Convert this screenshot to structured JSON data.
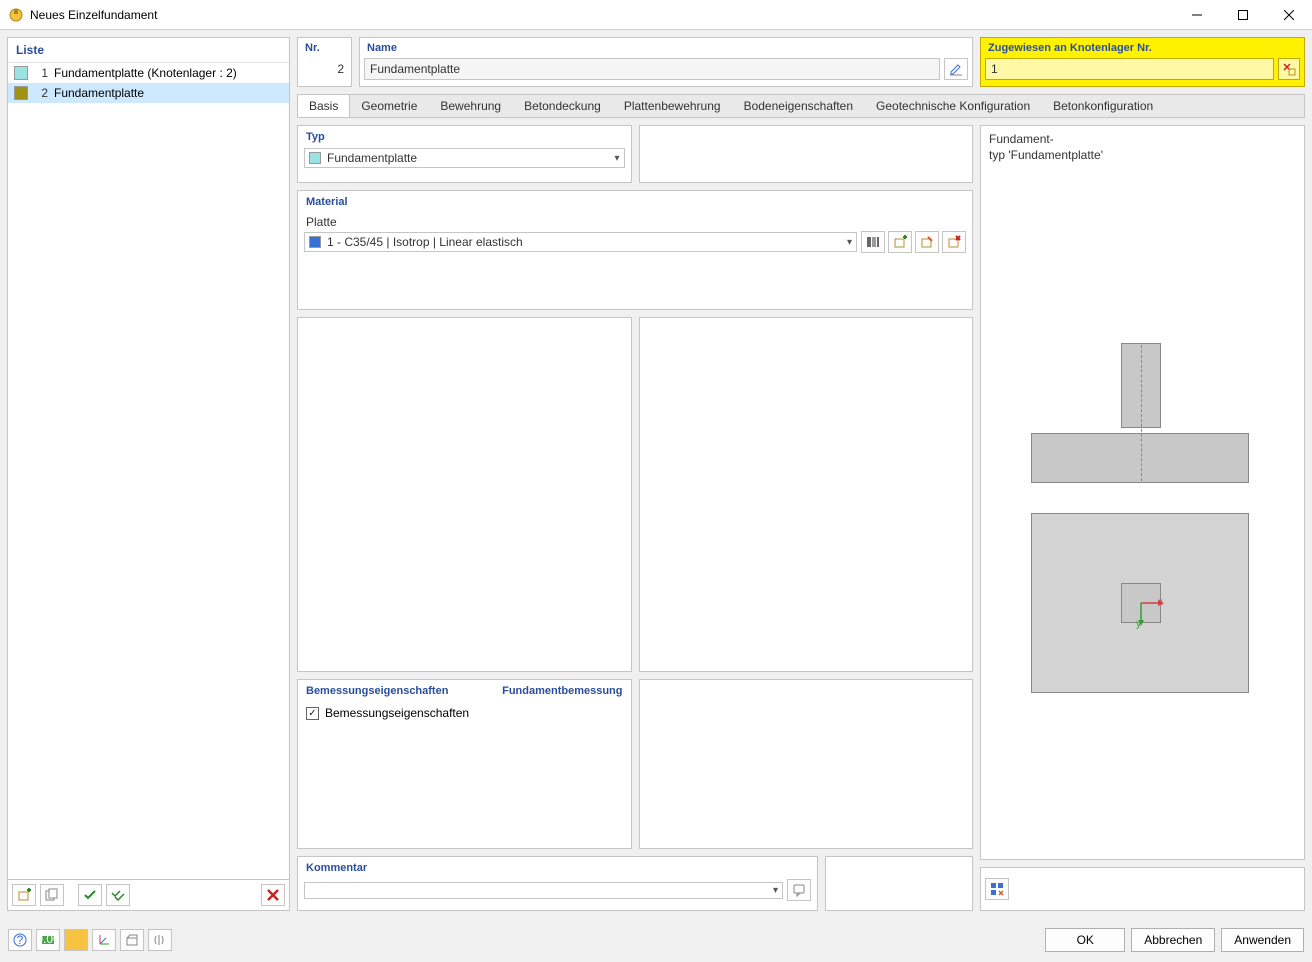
{
  "title": "Neues Einzelfundament",
  "list": {
    "header": "Liste",
    "items": [
      {
        "idx": "1",
        "label": "Fundamentplatte (Knotenlager : 2)",
        "swatch": "teal",
        "selected": false
      },
      {
        "idx": "2",
        "label": "Fundamentplatte",
        "swatch": "olive",
        "selected": true
      }
    ]
  },
  "hdr": {
    "nr_label": "Nr.",
    "nr_value": "2",
    "name_label": "Name",
    "name_value": "Fundamentplatte",
    "assign_label": "Zugewiesen an Knotenlager Nr.",
    "assign_value": "1"
  },
  "tabs": [
    "Basis",
    "Geometrie",
    "Bewehrung",
    "Betondeckung",
    "Plattenbewehrung",
    "Bodeneigenschaften",
    "Geotechnische Konfiguration",
    "Betonkonfiguration"
  ],
  "active_tab": 0,
  "typ": {
    "header": "Typ",
    "value": "Fundamentplatte"
  },
  "material": {
    "header": "Material",
    "plate_label": "Platte",
    "plate_value": "1 - C35/45 | Isotrop | Linear elastisch"
  },
  "design": {
    "header": "Bemessungseigenschaften",
    "link": "Fundamentbemessung",
    "chk_label": "Bemessungseigenschaften",
    "chk_checked": true
  },
  "kommentar": {
    "header": "Kommentar",
    "value": ""
  },
  "preview": {
    "line1": "Fundament-",
    "line2": "typ 'Fundamentplatte'"
  },
  "buttons": {
    "ok": "OK",
    "cancel": "Abbrechen",
    "apply": "Anwenden"
  }
}
